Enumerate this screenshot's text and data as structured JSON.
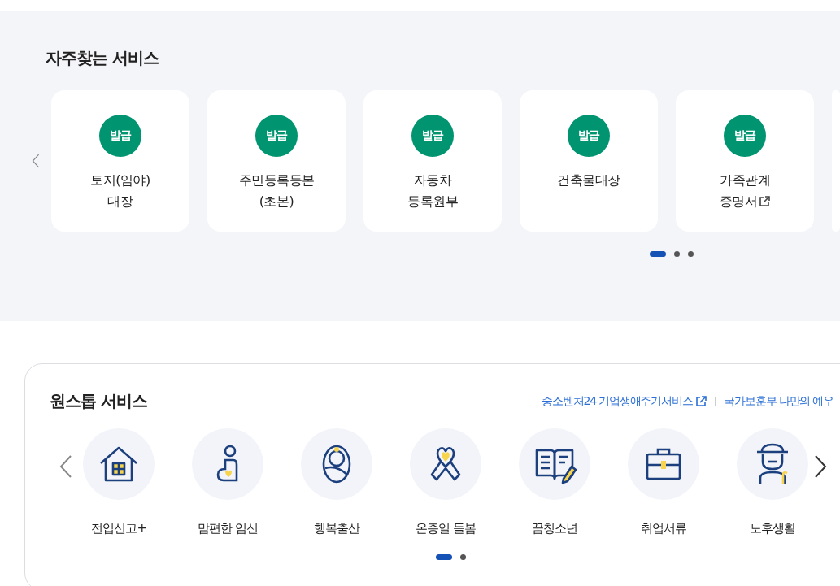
{
  "frequent_services": {
    "title": "자주찾는 서비스",
    "cards": [
      {
        "badge": "발급",
        "lines": [
          "토지(임야)",
          "대장"
        ],
        "external": false
      },
      {
        "badge": "발급",
        "lines": [
          "주민등록등본",
          "(초본)"
        ],
        "external": false
      },
      {
        "badge": "발급",
        "lines": [
          "자동차",
          "등록원부"
        ],
        "external": false
      },
      {
        "badge": "발급",
        "lines": [
          "건축물대장"
        ],
        "external": false
      },
      {
        "badge": "발급",
        "lines": [
          "가족관계",
          "증명서"
        ],
        "external": true
      }
    ],
    "pages": [
      {
        "selected": true
      },
      {
        "selected": false
      },
      {
        "selected": false
      }
    ]
  },
  "onestop_services": {
    "title": "원스톱 서비스",
    "links": [
      {
        "label": "중소벤처24 기업생애주기서비스",
        "external": true
      },
      {
        "label": "국가보훈부 나만의 예우",
        "external": false
      }
    ],
    "items": [
      {
        "label": "전입신고+"
      },
      {
        "label": "맘편한 임신"
      },
      {
        "label": "행복출산"
      },
      {
        "label": "온종일 돌봄"
      },
      {
        "label": "꿈청소년"
      },
      {
        "label": "취업서류"
      },
      {
        "label": "노후생활"
      }
    ],
    "pages": [
      {
        "selected": true
      },
      {
        "selected": false
      }
    ]
  }
}
